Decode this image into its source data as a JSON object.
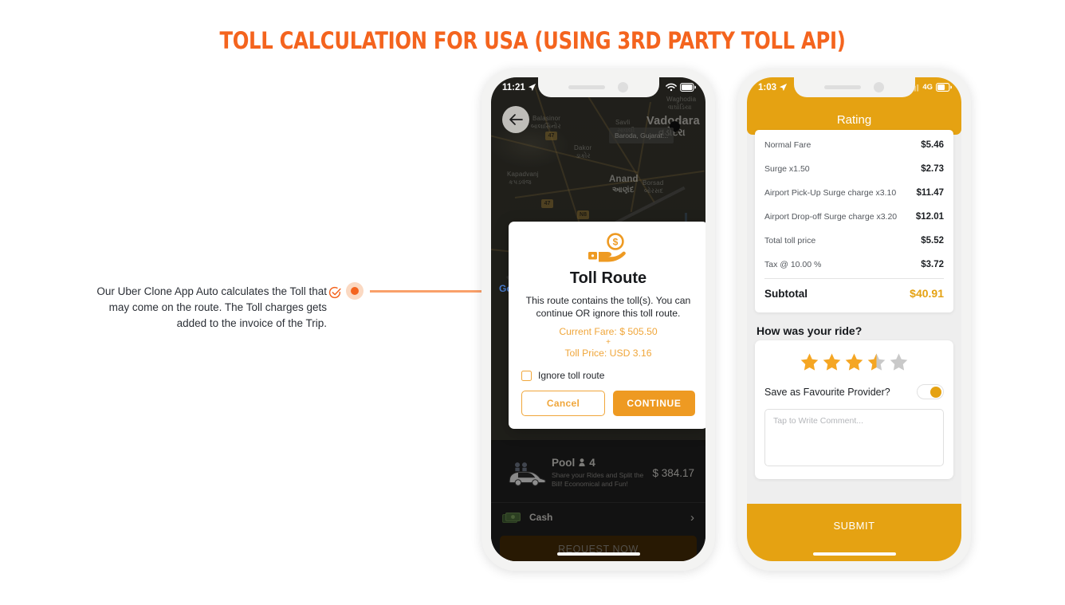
{
  "page": {
    "title": "TOLL CALCULATION FOR USA (USING 3RD PARTY TOLL API)",
    "title_color": "#F4641E",
    "background": "#FFFFFF"
  },
  "annotation": {
    "caption": "Our Uber Clone App Auto calculates the Toll that may come on the route. The Toll charges gets added to the invoice of the Trip.",
    "check_icon": "check-circle-icon",
    "bullet_icon": "bullet-dot-icon",
    "connector_color": "#F9A06A"
  },
  "phone1": {
    "status_bar": {
      "time": "11:21",
      "location_icon": "location-arrow-icon",
      "wifi_icon": "wifi-icon",
      "battery_icon": "battery-icon"
    },
    "back_icon": "back-arrow-icon",
    "map": {
      "attribution": "Go",
      "tooltip": "Baroda, Gujarat...",
      "labels": [
        {
          "name": "Balasinor",
          "sub": "બાલાસિનોર",
          "type": "small"
        },
        {
          "name": "Kapadvanj",
          "sub": "કપડવંજ",
          "type": "small"
        },
        {
          "name": "Dakor",
          "sub": "ડાકોર",
          "type": "small"
        },
        {
          "name": "Savli",
          "sub": "સાવલી",
          "type": "small"
        },
        {
          "name": "Vadodara",
          "sub": "વડોદરા",
          "type": "big"
        },
        {
          "name": "Anand",
          "sub": "આણંદ",
          "type": "med"
        },
        {
          "name": "Borsad",
          "sub": "બોરસદ",
          "type": "small"
        },
        {
          "name": "Waghodia",
          "sub": "વાઘોડિયા",
          "type": "small"
        }
      ],
      "shields": [
        "47",
        "47",
        "N8"
      ]
    },
    "modal": {
      "icon": "hand-holding-dollar-icon",
      "title": "Toll Route",
      "description": "This route contains the toll(s). You can continue OR ignore this toll route.",
      "current_fare": "Current Fare: $ 505.50",
      "plus": "+",
      "toll_price": "Toll Price: USD 3.16",
      "checkbox_label": "Ignore toll route",
      "checkbox_checked": false,
      "cancel_label": "Cancel",
      "continue_label": "CONTINUE",
      "accent_color": "#EE9A22"
    },
    "sheet": {
      "ride_icon": "pool-car-icon",
      "ride_name": "Pool",
      "seat_icon": "person-icon",
      "seats": "4",
      "ride_desc": "Share your Rides and Split the Bill! Economical and Fun!",
      "ride_price": "$ 384.17",
      "payment_icon": "cash-icon",
      "payment_label": "Cash",
      "payment_chevron": "chevron-right-icon",
      "request_label": "REQUEST NOW"
    }
  },
  "phone2": {
    "status_bar": {
      "time": "1:03",
      "location_icon": "location-arrow-icon",
      "signal_icon": "signal-bars-icon",
      "network": "4G",
      "battery_icon": "battery-icon"
    },
    "header_title": "Rating",
    "header_color": "#E5A212",
    "receipt": {
      "rows": [
        {
          "label": "Normal Fare",
          "value": "$5.46"
        },
        {
          "label": "Surge x1.50",
          "value": "$2.73"
        },
        {
          "label": "Airport Pick-Up Surge charge x3.10",
          "value": "$11.47"
        },
        {
          "label": "Airport Drop-off Surge charge x3.20",
          "value": "$12.01"
        },
        {
          "label": "Total toll price",
          "value": "$5.52"
        },
        {
          "label": "Tax @ 10.00 %",
          "value": "$3.72"
        }
      ],
      "total_label": "Subtotal",
      "total_value": "$40.91",
      "total_color": "#E5A212"
    },
    "rating": {
      "question": "How was your ride?",
      "stars_filled": 3,
      "stars_half": 1,
      "stars_total": 5,
      "star_color": "#F5A623",
      "star_empty_color": "#C9C9C9",
      "favourite_label": "Save as Favourite Provider?",
      "favourite_on": true,
      "comment_placeholder": "Tap to Write Comment..."
    },
    "submit_label": "SUBMIT"
  }
}
